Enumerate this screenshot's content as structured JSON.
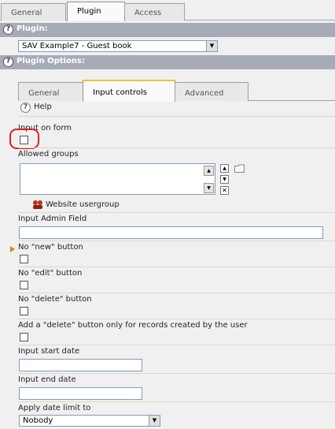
{
  "top_tabs": [
    {
      "label": "General",
      "active": false
    },
    {
      "label": "Plugin",
      "active": true
    },
    {
      "label": "Access",
      "active": false
    }
  ],
  "plugin_section": {
    "title": "Plugin:",
    "selected_plugin": "SAV Example7 - Guest book"
  },
  "options_section": {
    "title": "Plugin Options:"
  },
  "inner_tabs": [
    {
      "label": "General",
      "active": false
    },
    {
      "label": "Input controls",
      "active": true
    },
    {
      "label": "Advanced",
      "active": false
    }
  ],
  "help_label": "Help",
  "fields": {
    "input_on_form": "Input on form",
    "allowed_groups": "Allowed groups",
    "website_usergroup": "Website usergroup",
    "input_admin_field": "Input Admin Field",
    "no_new_button": "No \"new\" button",
    "no_edit_button": "No \"edit\" button",
    "no_delete_button": "No \"delete\" button",
    "delete_own_records": "Add a \"delete\" button only for records created by the user",
    "input_start_date": "Input start date",
    "input_end_date": "Input end date",
    "apply_date_limit": "Apply date limit to",
    "apply_date_limit_value": "Nobody"
  },
  "icons": {
    "help": "?",
    "arrow_up": "▲",
    "arrow_down": "▼",
    "delete": "✕"
  },
  "colors": {
    "section_header": "#a7abb8",
    "active_tab_highlight": "#f4c430",
    "annotation_circle": "#e02020",
    "pointer": "#d08a10"
  }
}
